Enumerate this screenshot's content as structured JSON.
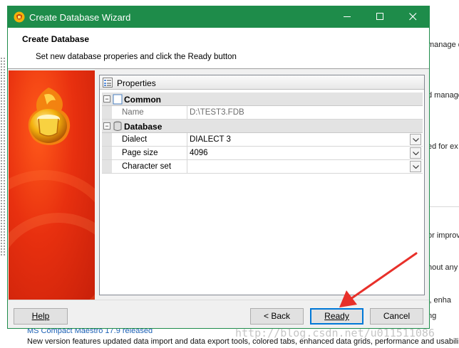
{
  "window": {
    "title": "Create Database Wizard"
  },
  "header": {
    "title": "Create Database",
    "subtitle": "Set new database properies and click the Ready button"
  },
  "properties": {
    "label": "Properties",
    "categories": [
      {
        "name": "Common",
        "rows": [
          {
            "name": "Name",
            "value": "D:\\TEST3.FDB"
          }
        ]
      },
      {
        "name": "Database",
        "rows": [
          {
            "name": "Dialect",
            "value": "DIALECT 3"
          },
          {
            "name": "Page size",
            "value": "4096"
          },
          {
            "name": "Character set",
            "value": ""
          }
        ]
      }
    ]
  },
  "buttons": {
    "help": "Help",
    "back": "< Back",
    "ready": "Ready",
    "cancel": "Cancel"
  },
  "background": {
    "snippets": [
      "manage d",
      "d manage",
      "ed for ex",
      "or improv",
      "hout any",
      "i, enha",
      "ng"
    ],
    "news_title": "MS Compact Maestro 17.9 released",
    "news_text": "New version features updated data import and data export tools, colored tabs, enhanced data grids, performance and usabili",
    "watermark": "http://blog.csdn.net/u011511086"
  },
  "colors": {
    "titlebar": "#1e8c4a",
    "accent": "#0078d7",
    "arrow": "#e8302a",
    "sidepanel": "#e8300f"
  }
}
